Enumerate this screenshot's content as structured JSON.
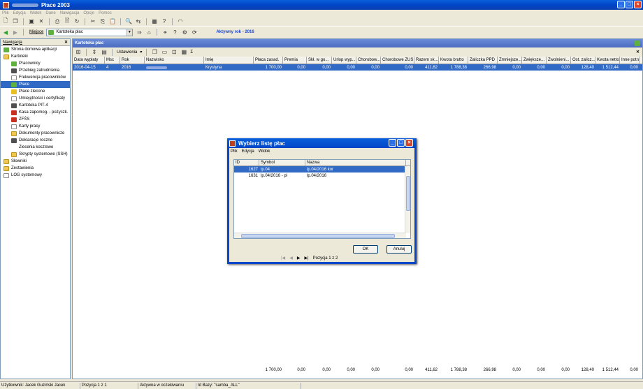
{
  "app": {
    "title": "Płace 2003"
  },
  "menu": [
    "Plik",
    "Edycja",
    "Widok",
    "Dane",
    "Nawigacja",
    "Opcje",
    "Pomoc"
  ],
  "toolbar": {
    "location_label": "Miejsce",
    "location_value": "Kartoteka płac",
    "active_year": "Aktywny rok - 2016"
  },
  "nav": {
    "header": "Nawigacja",
    "close": "✕",
    "items": [
      {
        "label": "Strona domowa aplikacji",
        "level": 0
      },
      {
        "label": "Kartoteki",
        "level": 0
      },
      {
        "label": "Pracownicy",
        "level": 1
      },
      {
        "label": "Przebieg zatrudnienia",
        "level": 1
      },
      {
        "label": "Frekwencja pracowników",
        "level": 1
      },
      {
        "label": "Płace",
        "level": 1
      },
      {
        "label": "Płace zlecone",
        "level": 1
      },
      {
        "label": "Umiejętności i certyfikaty",
        "level": 1
      },
      {
        "label": "Kartoteka PIT-4",
        "level": 1
      },
      {
        "label": "Kasa zapomog. - pożyczk.",
        "level": 1
      },
      {
        "label": "ZFŚS",
        "level": 1
      },
      {
        "label": "Karty pracy",
        "level": 1
      },
      {
        "label": "Dokumenty pracownicze",
        "level": 1
      },
      {
        "label": "Deklaracje roczne",
        "level": 1
      },
      {
        "label": "Zlecenia kosztowe",
        "level": 1
      },
      {
        "label": "Skrypty systemowe (SSH)",
        "level": 1
      },
      {
        "label": "Słowniki",
        "level": 0
      },
      {
        "label": "Zestawienia",
        "level": 0
      },
      {
        "label": "LOG systemowy",
        "level": 0
      }
    ]
  },
  "main": {
    "title": "Kartoteka płac",
    "settings_label": "Ustawienia",
    "sigma": "Σ",
    "columns": [
      "Data wypłaty",
      "Msc",
      "Rok",
      "Nazwisko",
      "Imię",
      "Płaca zasad.",
      "Premia",
      "Skł. w go...",
      "Urlop wyp...",
      "Chorobow...",
      "Chorobowe ZUS",
      "Razem sk...",
      "Kwota brutto",
      "Zaliczka PPD",
      "Zmniejsze...",
      "Zwiększe...",
      "Zwolnieni...",
      "Ost. zalicz...",
      "Kwota netto",
      "Inne potrą..."
    ],
    "row": [
      "2016-04-15",
      "4",
      "2016",
      "",
      "Krystyna",
      "1 700,00",
      "0,00",
      "0,00",
      "0,00",
      "0,00",
      "0,00",
      "411,62",
      "1 788,38",
      "266,98",
      "0,00",
      "0,00",
      "0,00",
      "128,40",
      "1 512,44",
      "0,00"
    ],
    "totals": [
      "1 700,00",
      "0,00",
      "0,00",
      "0,00",
      "0,00",
      "0,00",
      "411,62",
      "1 788,38",
      "266,98",
      "0,00",
      "0,00",
      "0,00",
      "128,40",
      "1 512,44",
      "0,00"
    ]
  },
  "dialog": {
    "title": "Wybierz listę płac",
    "menu": [
      "Plik",
      "Edycja",
      "Widok"
    ],
    "columns": [
      "ID",
      "Symbol",
      "Nazwa"
    ],
    "rows": [
      {
        "id": "1627",
        "symbol": "lp.04",
        "name": "lp.04/2016 kor"
      },
      {
        "id": "1631",
        "symbol": "lp.04/2016 - pl",
        "name": "lp.04/2016"
      }
    ],
    "ok": "OK",
    "cancel": "Anuluj",
    "position": "Pozycja 1 z 2"
  },
  "status": [
    "Użytkownik: Jacek Guziński Jacek",
    "Pozycja 1 z 1",
    "Aktywna w oczekiwaniu",
    "Id Bazy: \"samba_ALL\""
  ]
}
